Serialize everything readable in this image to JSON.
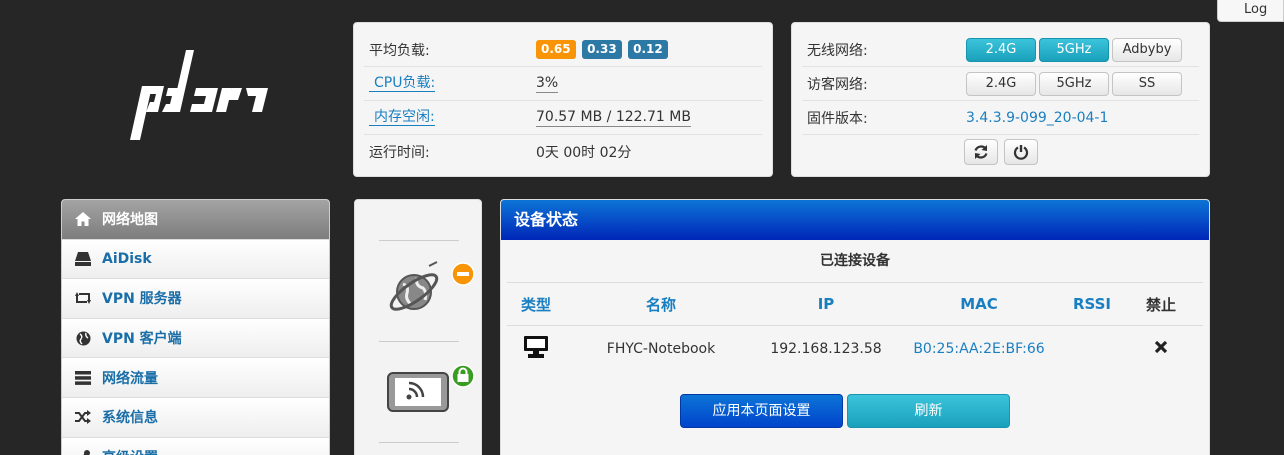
{
  "header": {
    "logout_label": "Log"
  },
  "status": {
    "load_label": "平均负载:",
    "load_badges": [
      "0.65",
      "0.33",
      "0.12"
    ],
    "cpu_label": "CPU负载:",
    "cpu_value": "3%",
    "mem_label": "内存空闲:",
    "mem_value": "70.57 MB / 122.71 MB",
    "uptime_label": "运行时间:",
    "uptime_value": "0天 00时 02分"
  },
  "wifi": {
    "wireless_label": "无线网络:",
    "wireless_buttons": [
      "2.4G",
      "5GHz",
      "Adbyby"
    ],
    "guest_label": "访客网络:",
    "guest_buttons": [
      "2.4G",
      "5GHz",
      "SS"
    ],
    "firmware_label": "固件版本:",
    "firmware_value": "3.4.3.9-099_20-04-1"
  },
  "sidebar": {
    "items": [
      {
        "label": "网络地图",
        "icon": "home-icon"
      },
      {
        "label": "AiDisk",
        "icon": "disk-icon"
      },
      {
        "label": "VPN 服务器",
        "icon": "retweet-icon"
      },
      {
        "label": "VPN 客户端",
        "icon": "globe-icon"
      },
      {
        "label": "网络流量",
        "icon": "list-icon"
      },
      {
        "label": "系统信息",
        "icon": "shuffle-icon"
      },
      {
        "label": "高级设置",
        "icon": "wrench-icon"
      }
    ]
  },
  "devices": {
    "title": "设备状态",
    "subtitle": "已连接设备",
    "columns": [
      "类型",
      "名称",
      "IP",
      "MAC",
      "RSSI",
      "禁止"
    ],
    "rows": [
      {
        "type": "desktop-icon",
        "name": "FHYC-Notebook",
        "ip": "192.168.123.58",
        "mac": "B0:25:AA:2E:BF:66",
        "rssi": ""
      }
    ],
    "apply_label": "应用本页面设置",
    "refresh_label": "刷新"
  },
  "colors": {
    "accent": "#1a7fc1",
    "header_blue": "#0044cc",
    "info": "#1aa0bb",
    "warning": "#f89406",
    "success": "#3a9d23"
  }
}
